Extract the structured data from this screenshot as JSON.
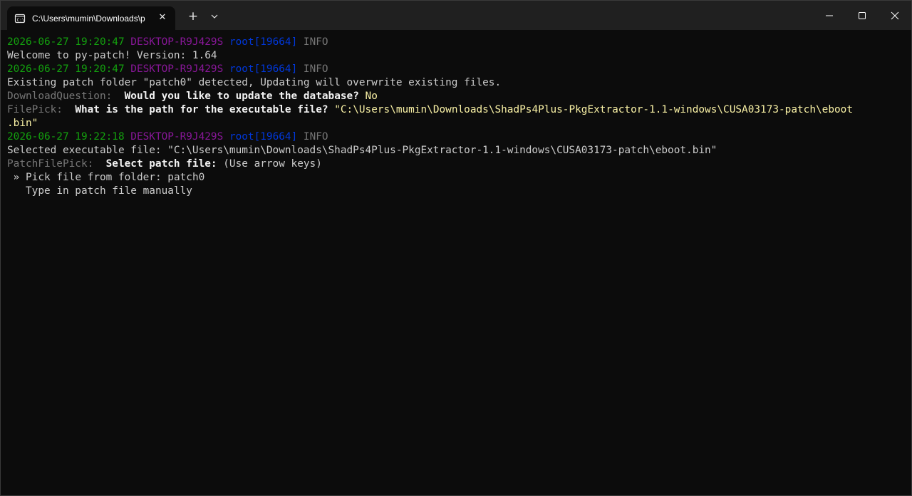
{
  "window": {
    "tab_title": "C:\\Users\\mumin\\Downloads\\p",
    "tab_icon": "terminal-icon",
    "new_tab_label": "+",
    "close_tab_label": "✕"
  },
  "terminal": {
    "log1": {
      "date": "2026-06-27 19:20:47",
      "host": "DESKTOP-R9J429S",
      "proc": "root[19664]",
      "level": "INFO"
    },
    "welcome": "Welcome to py-patch! Version: 1.64",
    "log2": {
      "date": "2026-06-27 19:20:47",
      "host": "DESKTOP-R9J429S",
      "proc": "root[19664]",
      "level": "INFO"
    },
    "existing": "Existing patch folder \"patch0\" detected, Updating will overwrite existing files.",
    "download_prompt": {
      "name": "DownloadQuestion:",
      "question": "Would you like to update the database?",
      "answer": "No"
    },
    "filepick_prompt": {
      "name": "FilePick:",
      "question": "What is the path for the executable file?",
      "answer_line1": "\"C:\\Users\\mumin\\Downloads\\ShadPs4Plus-PkgExtractor-1.1-windows\\CUSA03173-patch\\eboot",
      "answer_line2": ".bin\""
    },
    "log3": {
      "date": "2026-06-27 19:22:18",
      "host": "DESKTOP-R9J429S",
      "proc": "root[19664]",
      "level": "INFO"
    },
    "selected": "Selected executable file: \"C:\\Users\\mumin\\Downloads\\ShadPs4Plus-PkgExtractor-1.1-windows\\CUSA03173-patch\\eboot.bin\"",
    "patch_prompt": {
      "name": "PatchFilePick:",
      "question": "Select patch file:",
      "hint": "(Use arrow keys)"
    },
    "options": [
      {
        "marker": "»",
        "label": "Pick file from folder: patch0"
      },
      {
        "marker": "",
        "label": "Type in patch file manually"
      }
    ]
  },
  "colors": {
    "background": "#0c0c0c",
    "titlebar": "#202020",
    "date": "#13a10e",
    "host": "#881798",
    "process": "#0037da",
    "level": "#767676",
    "answer": "#f9f1a5"
  }
}
